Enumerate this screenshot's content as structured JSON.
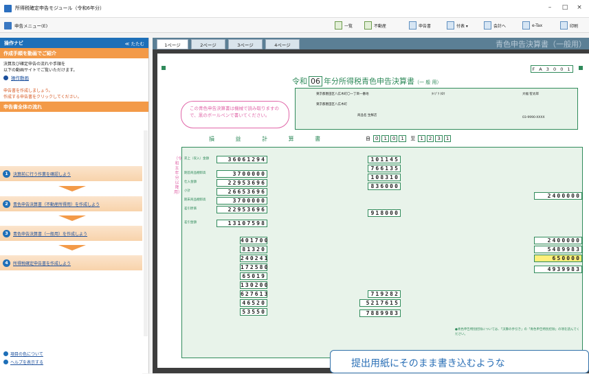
{
  "window": {
    "title": "所得税確定申告モジュール（令和6年分）",
    "min": "–",
    "max": "□",
    "close": "×"
  },
  "toolbar": {
    "menu": "申告メニュー(E)",
    "buttons": [
      "一覧",
      "不動産",
      "申告書",
      "付表 ▾",
      "会計へ",
      "e-Tax",
      "印刷"
    ]
  },
  "nav": {
    "header": "操作ナビ",
    "collapse": "≪ たたむ",
    "video_section": "作成手順を動画でご紹介",
    "video_text": "決算及び確定申告の流れや手順を\n以下の動画サイトでご覧いただけます。",
    "video_link": "操作動画",
    "info_text": "申告書を作成しましょう。\n作成する申告書をクリックしてください。",
    "flow_section": "申告書全体の流れ",
    "steps": [
      {
        "num": "1",
        "label": "決算前に行う作業を確認しよう"
      },
      {
        "num": "2",
        "label": "青色申告決算書（不動産所得用）を作成しよう"
      },
      {
        "num": "3",
        "label": "青色申告決算書（一般用）を作成しよう"
      },
      {
        "num": "4",
        "label": "所得税確定申告書を作成しよう"
      }
    ],
    "bottom": [
      "項目の色について",
      "ヘルプを表示する"
    ]
  },
  "tabs": [
    "1ページ",
    "2ページ",
    "3ページ",
    "4ページ"
  ],
  "tab_title": "青色申告決算書（一般用）",
  "form": {
    "title_pre": "令和",
    "year": "06",
    "title_post": "年分所得税青色申告決算書",
    "title_kind": "（一 般 用）",
    "id": "F A 3 0 0 1",
    "note_oval": "この青色申告決算書は機械で読み取りますので、黒のボールペンで書いてください。",
    "section": "損 益 計 算 書",
    "period_from": [
      "0",
      "1",
      "0",
      "1"
    ],
    "period_to": [
      "1",
      "2",
      "3",
      "1"
    ],
    "period_label_from": "自",
    "period_label_to": "至",
    "side_label": "（令和五年分以降用）",
    "addr": {
      "jusho": "東京都墨田区八広木町〇一丁目一番地",
      "name": "大幅 智太郎",
      "phone": "03-9990-XXXX",
      "shop": "東京都墨田区八広木町",
      "shop_name": "商品名 生鮮店",
      "kana_name": "ﾀｲﾌﾞｸ ﾀﾛｳ"
    },
    "left_amounts": [
      {
        "label": "売上（収入）金額",
        "value": "36061294"
      },
      {
        "label": "期首商品棚卸高",
        "value": "3700000"
      },
      {
        "label": "仕入金額",
        "value": "22953696"
      },
      {
        "label": "小計",
        "value": "26653696"
      },
      {
        "label": "期末商品棚卸高",
        "value": "3700000"
      },
      {
        "label": "差引原価",
        "value": "22953696"
      },
      {
        "label": "差引金額",
        "value": "13107598"
      }
    ],
    "expenses_left": [
      "401700",
      "81320",
      "240241",
      "172580",
      "65019",
      "130200",
      "627613",
      "46520",
      "53550"
    ],
    "expenses_mid": [
      "101145",
      "766135",
      "108310",
      "836000",
      "",
      "",
      "918000",
      "",
      "",
      "",
      "",
      "",
      "719282",
      "5217615",
      "7889983"
    ],
    "right_amounts": [
      "2400000",
      "2400000",
      "5489983",
      "650000",
      "4939983"
    ],
    "notes": "●青色申告特別控除については、「決算の手引き」の「青色申告特別控除」の項を読んでください。"
  },
  "popup": "提出用紙にそのまま書き込むような"
}
